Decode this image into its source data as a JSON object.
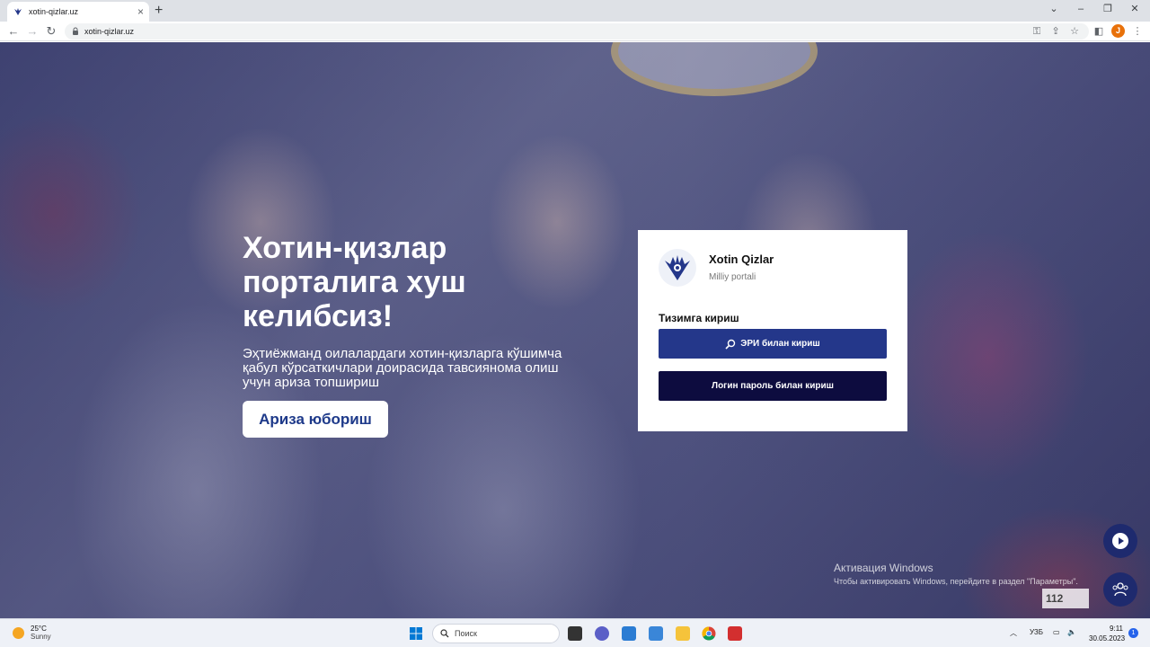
{
  "browser": {
    "tab_title": "xotin-qizlar.uz",
    "url": "xotin-qizlar.uz",
    "profile_initial": "J",
    "new_tab": "+",
    "close_tab": "×"
  },
  "hero": {
    "title": "Хотин-қизлар порталига хуш келибсиз!",
    "subtitle": "Эҳтиёжманд оилалардаги хотин-қизларга кўшимча қабул кўрсаткичлари доирасида тавсиянома олиш учун ариза топшириш",
    "apply_button": "Ариза юбориш"
  },
  "login_card": {
    "brand_name": "Xotin Qizlar",
    "brand_sub": "Milliy portali",
    "heading": "Тизимга кириш",
    "eri_button": "ЭРИ билан кириш",
    "login_button": "Логин пароль билан кириш"
  },
  "watermark": {
    "title": "Активация Windows",
    "text": "Чтобы активировать Windows, перейдите в раздел \"Параметры\".",
    "badge": "112"
  },
  "taskbar": {
    "temperature": "25°C",
    "condition": "Sunny",
    "search_label": "Поиск",
    "language": "УЗБ",
    "time": "9:11",
    "date": "30.05.2023",
    "notification_count": "1"
  },
  "colors": {
    "primary_blue": "#24378a",
    "dark_navy": "#0d0c3f",
    "accent_orange": "#e8710a"
  }
}
